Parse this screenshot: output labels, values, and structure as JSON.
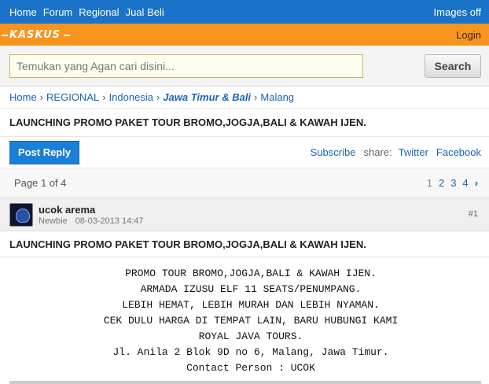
{
  "topnav": {
    "links": [
      "Home",
      "Forum",
      "Regional",
      "Jual Beli"
    ],
    "images_off": "Images off"
  },
  "brand": {
    "logo_text": "KASKUS",
    "login": "Login"
  },
  "search": {
    "placeholder": "Temukan yang Agan cari disini...",
    "button": "Search"
  },
  "breadcrumb": [
    "Home",
    "REGIONAL",
    "Indonesia",
    "Jawa Timur & Bali",
    "Malang"
  ],
  "thread": {
    "title": "LAUNCHING PROMO PAKET TOUR BROMO,JOGJA,BALI & KAWAH IJEN."
  },
  "actions": {
    "post_reply": "Post Reply",
    "subscribe": "Subscribe",
    "share_label": "share:",
    "twitter": "Twitter",
    "facebook": "Facebook"
  },
  "pager": {
    "info": "Page 1 of 4",
    "pages": [
      "1",
      "2",
      "3",
      "4"
    ],
    "current": "1",
    "next": "›"
  },
  "post": {
    "author": "ucok arema",
    "rank": "Newbie",
    "date": "08-03-2013 14:47",
    "number": "#1",
    "title": "LAUNCHING PROMO PAKET TOUR BROMO,JOGJA,BALI & KAWAH IJEN.",
    "body_lines": [
      "PROMO TOUR BROMO,JOGJA,BALI & KAWAH IJEN.",
      "ARMADA IZUSU ELF 11 SEATS/PENUMPANG.",
      "LEBIH HEMAT, LEBIH MURAH DAN LEBIH NYAMAN.",
      "CEK DULU HARGA DI TEMPAT LAIN, BARU HUBUNGI KAMI",
      "ROYAL JAVA TOURS.",
      "Jl. Anila 2 Blok 9D no 6, Malang, Jawa Timur.",
      "Contact Person : UCOK"
    ]
  }
}
